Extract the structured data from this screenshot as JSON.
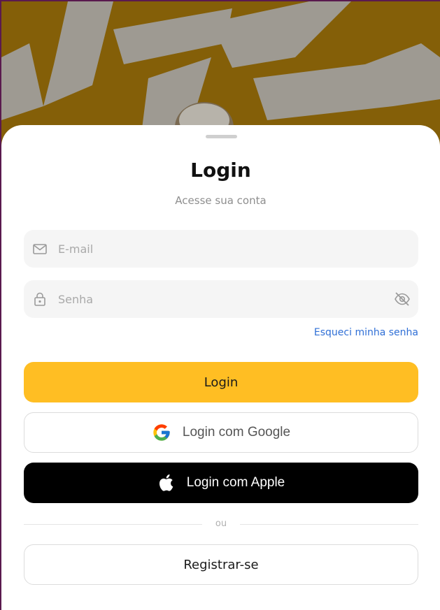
{
  "header": {
    "title": "Login",
    "subtitle": "Acesse sua conta"
  },
  "form": {
    "email": {
      "placeholder": "E-mail",
      "value": "",
      "icon": "mail-icon"
    },
    "password": {
      "placeholder": "Senha",
      "value": "",
      "icon": "lock-icon",
      "toggle_icon": "eye-off-icon"
    },
    "forgot_label": "Esqueci minha senha"
  },
  "buttons": {
    "login_label": "Login",
    "google_label": "Login com Google",
    "apple_label": "Login com Apple",
    "divider_label": "ou",
    "register_label": "Registrar-se"
  },
  "colors": {
    "primary": "#ffbe23",
    "link": "#2f6fd6",
    "apple_bg": "#000000",
    "sheet_bg": "#ffffff",
    "field_bg": "#f5f5f5"
  }
}
